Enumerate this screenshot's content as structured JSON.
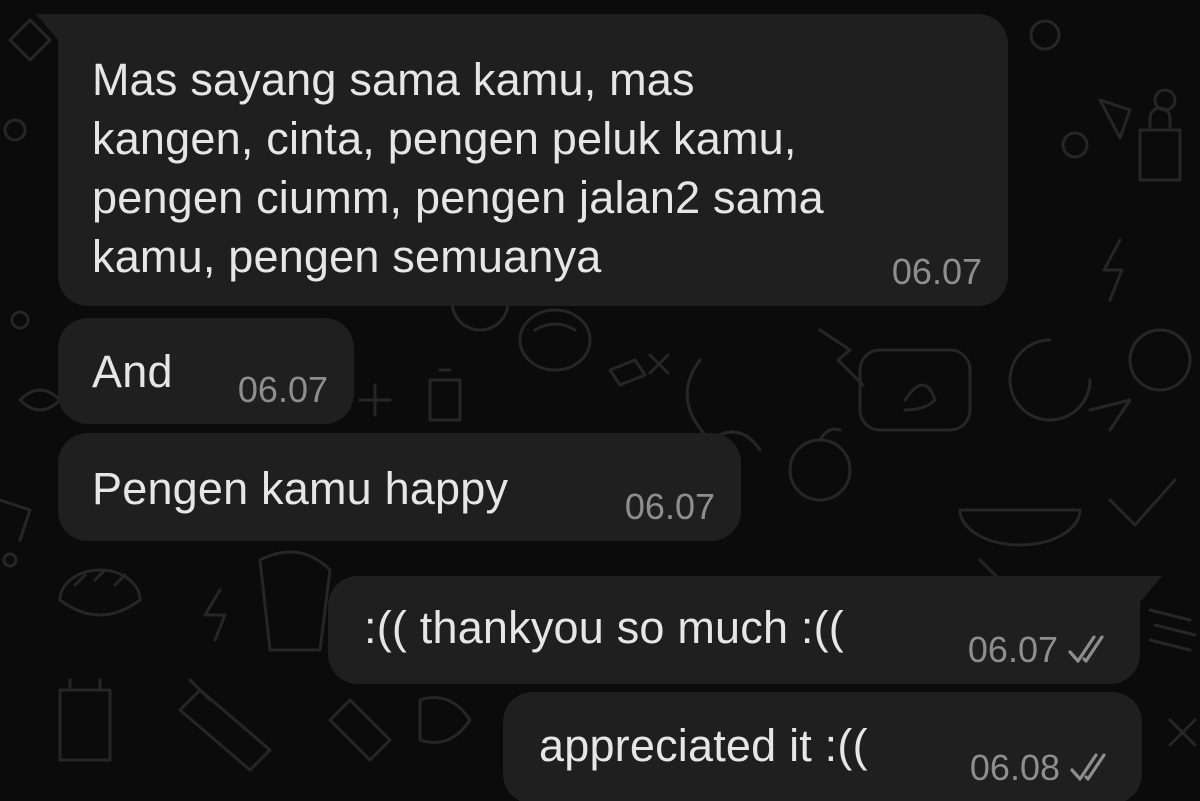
{
  "messages": [
    {
      "direction": "incoming",
      "text": "Mas sayang sama kamu, mas\nkangen, cinta, pengen peluk kamu,\npengen ciumm, pengen jalan2 sama\nkamu, pengen semuanya",
      "time": "06.07"
    },
    {
      "direction": "incoming",
      "text": "And",
      "time": "06.07"
    },
    {
      "direction": "incoming",
      "text": "Pengen kamu happy",
      "time": "06.07"
    },
    {
      "direction": "outgoing",
      "text": ":(( thankyou so much :((",
      "time": "06.07",
      "status": "read-double-check-icon"
    },
    {
      "direction": "outgoing",
      "text": "appreciated it :((",
      "time": "06.08",
      "status": "read-double-check-icon"
    }
  ],
  "colors": {
    "background": "#0b0b0b",
    "bubble": "#1f1f1f",
    "text": "#e6e6e6",
    "meta": "#8e8e8e",
    "doodle": "#262626"
  }
}
